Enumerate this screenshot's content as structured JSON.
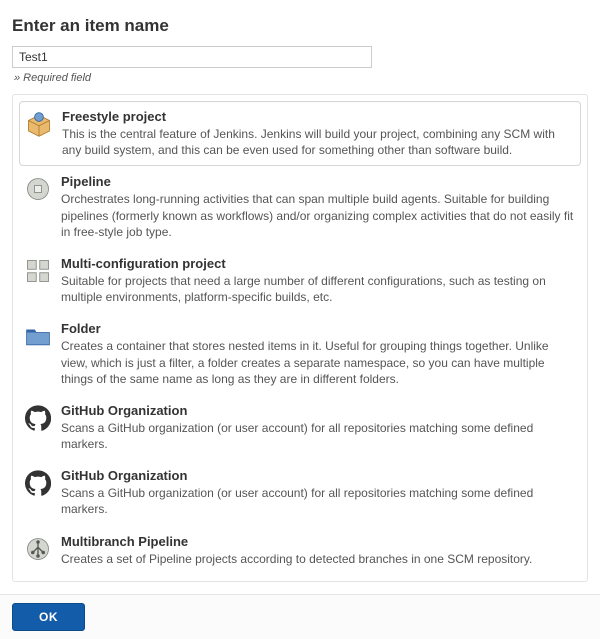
{
  "heading": "Enter an item name",
  "name_field": {
    "value": "Test1",
    "placeholder": ""
  },
  "required_text": "» Required field",
  "items": [
    {
      "id": "freestyle",
      "title": "Freestyle project",
      "desc": "This is the central feature of Jenkins. Jenkins will build your project, combining any SCM with any build system, and this can be even used for something other than software build.",
      "selected": true
    },
    {
      "id": "pipeline",
      "title": "Pipeline",
      "desc": "Orchestrates long-running activities that can span multiple build agents. Suitable for building pipelines (formerly known as workflows) and/or organizing complex activities that do not easily fit in free-style job type.",
      "selected": false
    },
    {
      "id": "multiconfig",
      "title": "Multi-configuration project",
      "desc": "Suitable for projects that need a large number of different configurations, such as testing on multiple environments, platform-specific builds, etc.",
      "selected": false
    },
    {
      "id": "folder",
      "title": "Folder",
      "desc": "Creates a container that stores nested items in it. Useful for grouping things together. Unlike view, which is just a filter, a folder creates a separate namespace, so you can have multiple things of the same name as long as they are in different folders.",
      "selected": false
    },
    {
      "id": "github-org-1",
      "title": "GitHub Organization",
      "desc": "Scans a GitHub organization (or user account) for all repositories matching some defined markers.",
      "selected": false
    },
    {
      "id": "github-org-2",
      "title": "GitHub Organization",
      "desc": "Scans a GitHub organization (or user account) for all repositories matching some defined markers.",
      "selected": false
    },
    {
      "id": "multibranch",
      "title": "Multibranch Pipeline",
      "desc": "Creates a set of Pipeline projects according to detected branches in one SCM repository.",
      "selected": false
    }
  ],
  "ok_label": "OK"
}
